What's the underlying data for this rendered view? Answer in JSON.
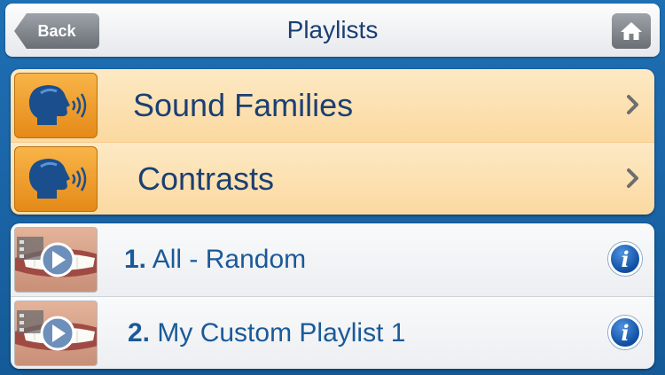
{
  "header": {
    "back_label": "Back",
    "title": "Playlists",
    "home_icon": "home-icon"
  },
  "categories": [
    {
      "label": "Sound Families",
      "icon": "speaking-head-icon"
    },
    {
      "label": "Contrasts",
      "icon": "speaking-head-icon"
    }
  ],
  "playlists": [
    {
      "number": "1.",
      "name": "All - Random",
      "icon": "video-play-icon"
    },
    {
      "number": "2.",
      "name": "My Custom Playlist 1",
      "icon": "video-play-icon"
    }
  ],
  "colors": {
    "background": "#1a64a8",
    "title_text": "#1b3f72",
    "category_row": "#fde3b4",
    "accent_orange": "#f0a030",
    "info_blue": "#0f4da2"
  }
}
